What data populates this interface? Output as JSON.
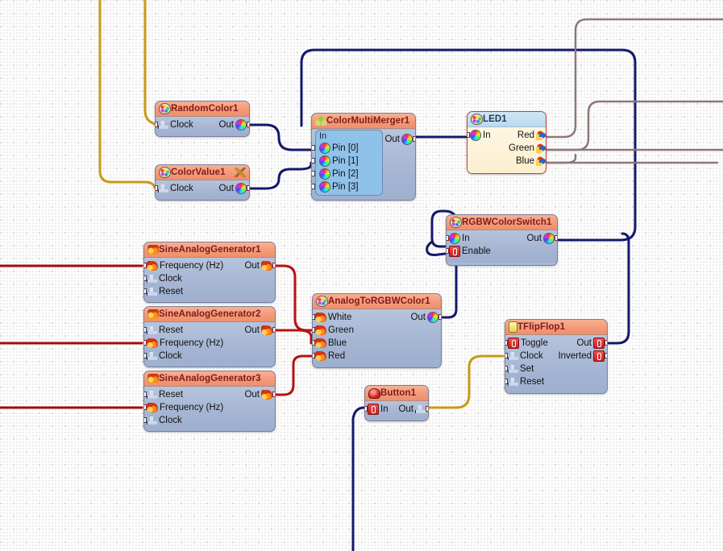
{
  "editor": {
    "grid_spacing_px": 16,
    "background_color": "#fdfdfb",
    "grid_dot_color": "#c9c9d6"
  },
  "wire_colors": {
    "color_wire": "#14186b",
    "analog_wire": "#b51212",
    "digital_wire": "#c79a16",
    "device_wire": "#8d7878"
  },
  "nodes": [
    {
      "id": "RandomColor1",
      "title": "RandomColor1",
      "icon": "palette-icon",
      "style": "standard",
      "inputs": [
        {
          "label": "Clock",
          "icon": "clock-icon"
        }
      ],
      "outputs": [
        {
          "label": "Out",
          "icon": "color-icon"
        }
      ]
    },
    {
      "id": "ColorValue1",
      "title": "ColorValue1",
      "icon": "palette-icon",
      "title_extra_icon": "wrench-icon",
      "style": "standard",
      "inputs": [
        {
          "label": "Clock",
          "icon": "clock-icon"
        }
      ],
      "outputs": [
        {
          "label": "Out",
          "icon": "color-icon"
        }
      ]
    },
    {
      "id": "ColorMultiMerger1",
      "title": "ColorMultiMerger1",
      "icon": "merger-icon",
      "style": "standard",
      "group_label": "In",
      "inputs": [
        {
          "label": "Pin [0]",
          "icon": "color-icon"
        },
        {
          "label": "Pin [1]",
          "icon": "color-icon"
        },
        {
          "label": "Pin [2]",
          "icon": "color-icon"
        },
        {
          "label": "Pin [3]",
          "icon": "color-icon"
        }
      ],
      "outputs": [
        {
          "label": "Out",
          "icon": "color-icon"
        }
      ]
    },
    {
      "id": "LED1",
      "title": "LED1",
      "icon": "palette-icon",
      "style": "device",
      "inputs": [
        {
          "label": "In",
          "icon": "color-icon"
        }
      ],
      "outputs": [
        {
          "label": "Red",
          "icon": "arrow-icon"
        },
        {
          "label": "Green",
          "icon": "arrow-icon"
        },
        {
          "label": "Blue",
          "icon": "arrow-icon"
        }
      ]
    },
    {
      "id": "RGBWColorSwitch1",
      "title": "RGBWColorSwitch1",
      "icon": "palette-icon",
      "style": "standard",
      "inputs": [
        {
          "label": "In",
          "icon": "color-icon"
        },
        {
          "label": "Enable",
          "icon": "bool-icon"
        }
      ],
      "outputs": [
        {
          "label": "Out",
          "icon": "color-icon"
        }
      ]
    },
    {
      "id": "SineAnalogGenerator1",
      "title": "SineAnalogGenerator1",
      "icon": "sine-icon",
      "style": "standard",
      "inputs": [
        {
          "label": "Frequency  (Hz)",
          "icon": "flame-icon"
        },
        {
          "label": "Clock",
          "icon": "clock-icon"
        },
        {
          "label": "Reset",
          "icon": "clock-icon"
        }
      ],
      "outputs": [
        {
          "label": "Out",
          "icon": "flame-icon"
        }
      ]
    },
    {
      "id": "SineAnalogGenerator2",
      "title": "SineAnalogGenerator2",
      "icon": "sine-icon",
      "style": "standard",
      "inputs": [
        {
          "label": "Reset",
          "icon": "clock-icon"
        },
        {
          "label": "Frequency  (Hz)",
          "icon": "flame-icon"
        },
        {
          "label": "Clock",
          "icon": "clock-icon"
        }
      ],
      "outputs": [
        {
          "label": "Out",
          "icon": "flame-icon"
        }
      ]
    },
    {
      "id": "SineAnalogGenerator3",
      "title": "SineAnalogGenerator3",
      "icon": "sine-icon",
      "style": "standard",
      "inputs": [
        {
          "label": "Reset",
          "icon": "clock-icon"
        },
        {
          "label": "Frequency  (Hz)",
          "icon": "flame-icon"
        },
        {
          "label": "Clock",
          "icon": "clock-icon"
        }
      ],
      "outputs": [
        {
          "label": "Out",
          "icon": "flame-icon"
        }
      ]
    },
    {
      "id": "AnalogToRGBWColor1",
      "title": "AnalogToRGBWColor1",
      "icon": "palette-icon",
      "style": "standard",
      "inputs": [
        {
          "label": "White",
          "icon": "flame-icon"
        },
        {
          "label": "Green",
          "icon": "flame-icon"
        },
        {
          "label": "Blue",
          "icon": "flame-icon"
        },
        {
          "label": "Red",
          "icon": "flame-icon"
        }
      ],
      "outputs": [
        {
          "label": "Out",
          "icon": "color-icon"
        }
      ]
    },
    {
      "id": "TFlipFlop1",
      "title": "TFlipFlop1",
      "icon": "flipflop-icon",
      "style": "standard",
      "inputs": [
        {
          "label": "Toggle",
          "icon": "bool-icon"
        },
        {
          "label": "Clock",
          "icon": "clock-icon"
        },
        {
          "label": "Set",
          "icon": "clock-icon"
        },
        {
          "label": "Reset",
          "icon": "clock-icon"
        }
      ],
      "outputs": [
        {
          "label": "Out",
          "icon": "bool-icon"
        },
        {
          "label": "Inverted",
          "icon": "bool-icon"
        }
      ]
    },
    {
      "id": "Button1",
      "title": "Button1",
      "icon": "button-icon",
      "style": "standard",
      "inputs": [
        {
          "label": "In",
          "icon": "bool-icon"
        }
      ],
      "outputs": [
        {
          "label": "Out",
          "icon": "clock-icon"
        }
      ]
    }
  ],
  "nodeText": {
    "RandomColor1": {
      "title": "RandomColor1",
      "i0": "Clock",
      "o0": "Out"
    },
    "ColorValue1": {
      "title": "ColorValue1",
      "i0": "Clock",
      "o0": "Out"
    },
    "ColorMultiMerger1": {
      "title": "ColorMultiMerger1",
      "group": "In",
      "i0": "Pin [0]",
      "i1": "Pin [1]",
      "i2": "Pin [2]",
      "i3": "Pin [3]",
      "o0": "Out"
    },
    "LED1": {
      "title": "LED1",
      "i0": "In",
      "o0": "Red",
      "o1": "Green",
      "o2": "Blue"
    },
    "RGBWColorSwitch1": {
      "title": "RGBWColorSwitch1",
      "i0": "In",
      "i1": "Enable",
      "o0": "Out"
    },
    "SineAnalogGenerator1": {
      "title": "SineAnalogGenerator1",
      "i0": "Frequency  (Hz)",
      "i1": "Clock",
      "i2": "Reset",
      "o0": "Out"
    },
    "SineAnalogGenerator2": {
      "title": "SineAnalogGenerator2",
      "i0": "Reset",
      "i1": "Frequency  (Hz)",
      "i2": "Clock",
      "o0": "Out"
    },
    "SineAnalogGenerator3": {
      "title": "SineAnalogGenerator3",
      "i0": "Reset",
      "i1": "Frequency  (Hz)",
      "i2": "Clock",
      "o0": "Out"
    },
    "AnalogToRGBWColor1": {
      "title": "AnalogToRGBWColor1",
      "i0": "White",
      "i1": "Green",
      "i2": "Blue",
      "i3": "Red",
      "o0": "Out"
    },
    "TFlipFlop1": {
      "title": "TFlipFlop1",
      "i0": "Toggle",
      "i1": "Clock",
      "i2": "Set",
      "i3": "Reset",
      "o0": "Out",
      "o1": "Inverted"
    },
    "Button1": {
      "title": "Button1",
      "i0": "In",
      "o0": "Out"
    }
  }
}
